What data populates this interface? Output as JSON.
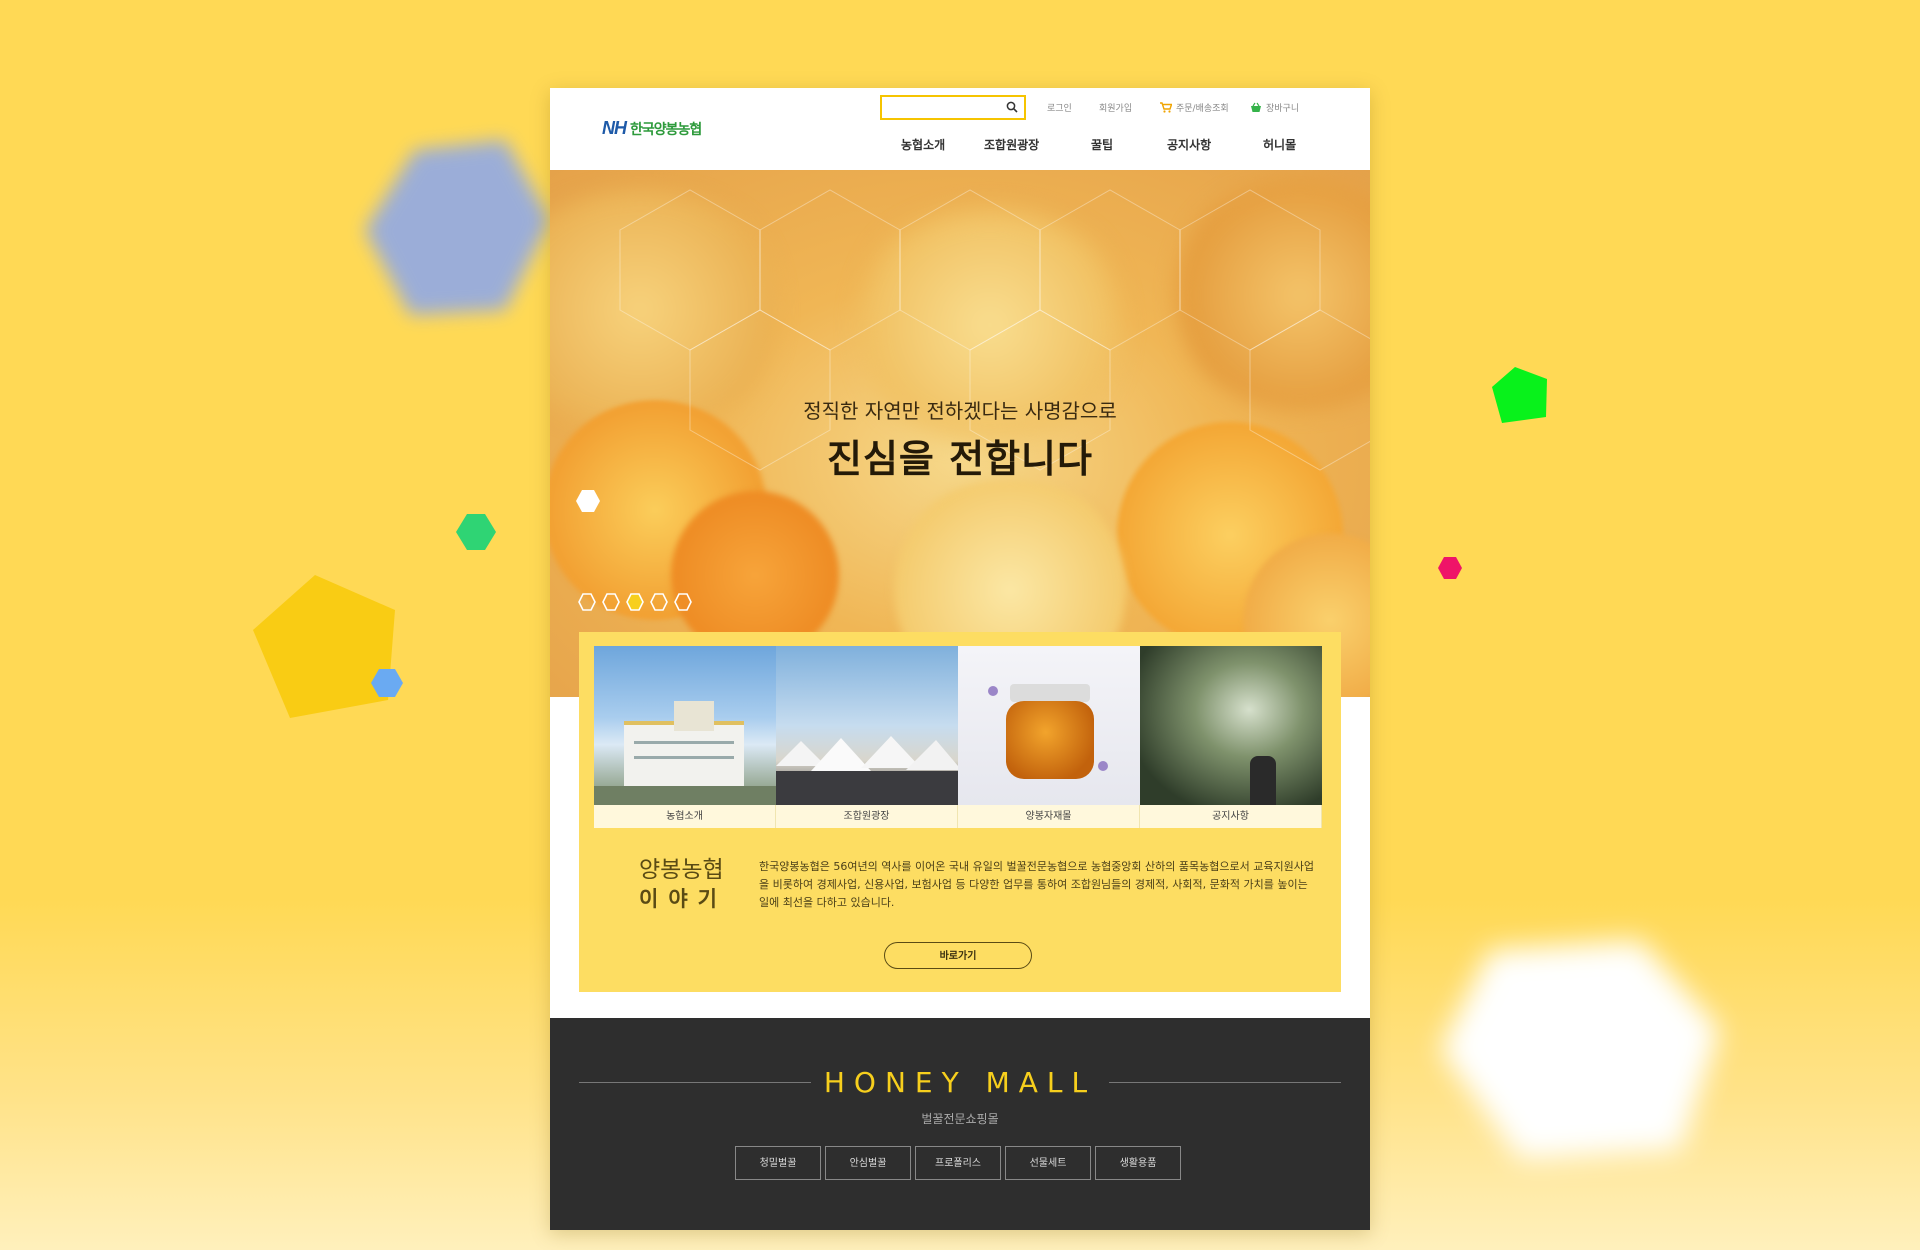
{
  "header": {
    "logo_nh": "NH",
    "logo_text": "한국양봉농협",
    "search_value": "",
    "login": "로그인",
    "join": "회원가입",
    "order": "주문/배송조회",
    "cart": "장바구니",
    "nav": [
      "농협소개",
      "조합원광장",
      "꿀팁",
      "공지사항",
      "허니몰"
    ]
  },
  "hero": {
    "subtitle": "정직한 자연만 전하겠다는 사명감으로",
    "title": "진심을 전합니다",
    "slides_total": 5,
    "slide_active": 3
  },
  "cards": [
    {
      "label": "농협소개"
    },
    {
      "label": "조합원광장"
    },
    {
      "label": "양봉자재몰"
    },
    {
      "label": "공지사항"
    }
  ],
  "story": {
    "title_line1": "양봉농협",
    "title_line2": "이야기",
    "text": "한국양봉농협은 56여년의 역사를 이어온 국내 유일의 벌꿀전문농협으로 농협중앙회 산하의 품목농협으로서 교육지원사업을 비롯하여 경제사업, 신용사업, 보험사업 등 다양한 업무를 통하여 조합원님들의 경제적, 사회적, 문화적 가치를 높이는 일에 최선을 다하고 있습니다.",
    "button": "바로가기"
  },
  "mall": {
    "title": "HONEY MALL",
    "subtitle": "벌꿀전문쇼핑몰",
    "buttons": [
      "청밀벌꿀",
      "안심벌꿀",
      "프로폴리스",
      "선물세트",
      "생활용품"
    ]
  },
  "colors": {
    "background": "#ffd955",
    "accent": "#f6c400",
    "panel": "#fddd62",
    "mall_bg": "#2e2e2e",
    "mall_title": "#f7cf1d"
  }
}
